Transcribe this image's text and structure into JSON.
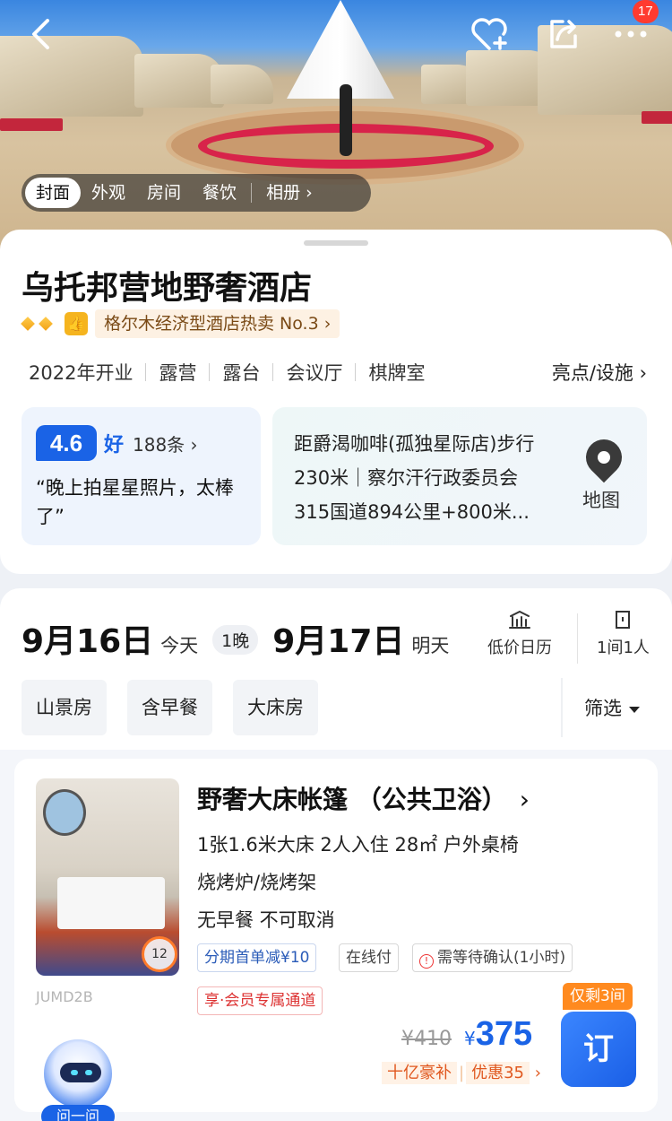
{
  "header": {
    "notification_count": "17",
    "photo_tabs": [
      "封面",
      "外观",
      "房间",
      "餐饮"
    ],
    "album_label": "相册",
    "icons": {
      "back": "back-chevron-icon",
      "favorite": "heart-plus-icon",
      "share": "share-icon",
      "more": "more-dots-icon"
    }
  },
  "hotel": {
    "name": "乌托邦营地野奢酒店",
    "rank_text": "格尔木经济型酒店热卖 No.3",
    "tags": [
      "2022年开业",
      "露营",
      "露台",
      "会议厅",
      "棋牌室"
    ],
    "facilities_label": "亮点/设施",
    "rating": {
      "score": "4.6",
      "word": "好",
      "count": "188条"
    },
    "review_quote": "“晚上拍星星照片，太棒了”",
    "location": {
      "line1": "距爵渴咖啡(孤独星际店)步行",
      "line2": "230米｜察尔汗行政委员会",
      "line3": "315国道894公里+800米..."
    },
    "map_label": "地图"
  },
  "booking": {
    "checkin": {
      "date": "9月16日",
      "label": "今天"
    },
    "nights": "1晚",
    "checkout": {
      "date": "9月17日",
      "label": "明天"
    },
    "calendar_label": "低价日历",
    "guests_label": "1间1人",
    "chips": [
      "山景房",
      "含早餐",
      "大床房"
    ],
    "filter_label": "筛选"
  },
  "room": {
    "title": "野奢大床帐篷 （公共卫浴）",
    "spec": "1张1.6米大床  2人入住  28㎡  户外桌椅",
    "extra": "烧烤炉/烧烤架",
    "policy": "无早餐  不可取消",
    "photo_count": "12",
    "code": "JUMD2B",
    "tags": [
      "分期首单减¥10",
      "在线付",
      "需等待确认(1小时)"
    ],
    "vip_tag": "享·会员专属通道",
    "remaining": "仅剩3间",
    "book_label": "订",
    "original_price": "¥410",
    "currency": "¥",
    "price": "375",
    "promo1": "十亿豪补",
    "promo2": "优惠35"
  },
  "assistant": {
    "label": "问一问"
  }
}
